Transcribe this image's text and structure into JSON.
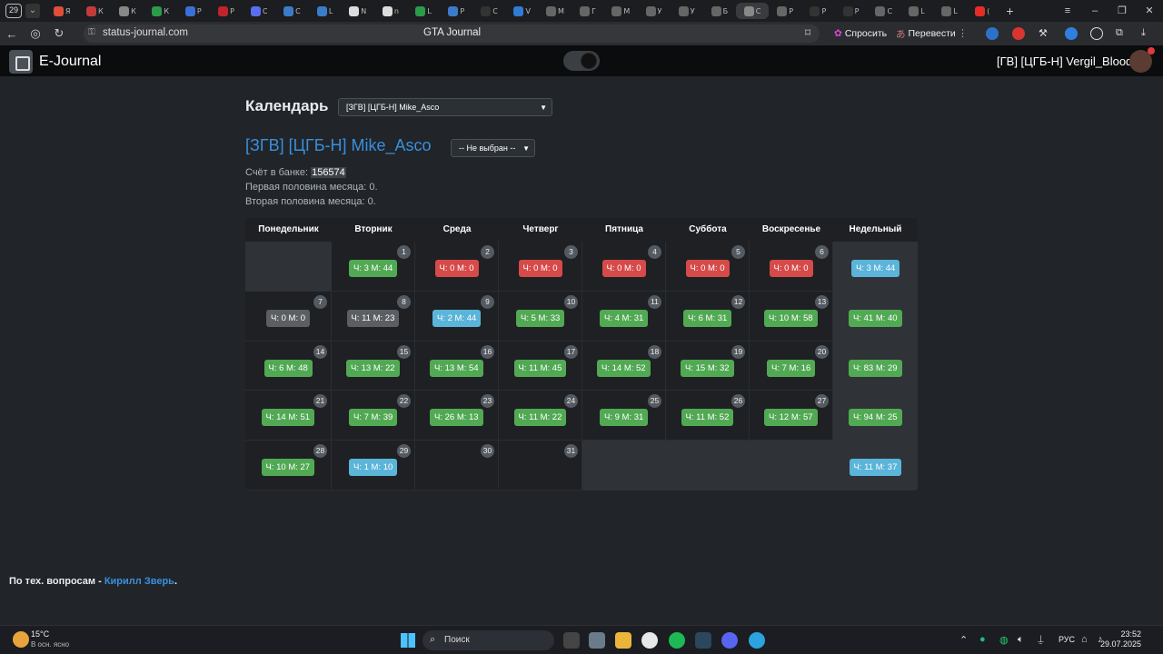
{
  "browser": {
    "tab_count": "29",
    "tabs": [
      {
        "title": "Я",
        "color": "#e04e39"
      },
      {
        "title": "К",
        "color": "#c23b3b"
      },
      {
        "title": "К",
        "color": "#888"
      },
      {
        "title": "К",
        "color": "#2b9b49"
      },
      {
        "title": "Р",
        "color": "#3a6fd8"
      },
      {
        "title": "Р",
        "color": "#c0232c"
      },
      {
        "title": "С",
        "color": "#5a6ef0"
      },
      {
        "title": "С",
        "color": "#3b7cc9"
      },
      {
        "title": "L",
        "color": "#3b7cc9"
      },
      {
        "title": "N",
        "color": "#ddd"
      },
      {
        "title": "n",
        "color": "#ddd"
      },
      {
        "title": "L",
        "color": "#2b9b49"
      },
      {
        "title": "Р",
        "color": "#3b7cc9"
      },
      {
        "title": "C",
        "color": "#333"
      },
      {
        "title": "V",
        "color": "#2f7bd6"
      },
      {
        "title": "М",
        "color": "#666"
      },
      {
        "title": "Г",
        "color": "#666"
      },
      {
        "title": "М",
        "color": "#666"
      },
      {
        "title": "У",
        "color": "#666"
      },
      {
        "title": "У",
        "color": "#666"
      },
      {
        "title": "Б",
        "color": "#666"
      },
      {
        "title": "С",
        "color": "#888"
      },
      {
        "title": "Р",
        "color": "#666"
      },
      {
        "title": "Р",
        "color": "#333"
      },
      {
        "title": "Р",
        "color": "#333"
      },
      {
        "title": "С",
        "color": "#666"
      },
      {
        "title": "L",
        "color": "#666"
      },
      {
        "title": "L",
        "color": "#666"
      },
      {
        "title": "(",
        "color": "#e52d27"
      }
    ],
    "url": "status-journal.com",
    "page_title": "GTA Journal",
    "ask_label": "Спросить",
    "translate_label": "Перевести"
  },
  "header": {
    "brand": "E-Journal",
    "user": "[ГВ] [ЦГБ-Н] Vergil_Blood"
  },
  "main": {
    "title": "Календарь",
    "employee_select": "[ЗГВ] [ЦГБ-Н] Mike_Asco",
    "person_name": "[ЗГВ] [ЦГБ-Н] Mike_Asco",
    "status_select": "-- Не выбран --",
    "bank_label": "Счёт в банке: ",
    "bank_value": "156574",
    "first_half": "Первая половина месяца: 0.",
    "second_half": "Вторая половина месяца: 0."
  },
  "calendar": {
    "days": [
      "Понедельник",
      "Вторник",
      "Среда",
      "Четверг",
      "Пятница",
      "Суббота",
      "Воскресенье",
      "Недельный"
    ],
    "weeks": [
      [
        null,
        {
          "d": "1",
          "t": "Ч: 3 М: 44",
          "c": "green"
        },
        {
          "d": "2",
          "t": "Ч: 0 М: 0",
          "c": "red"
        },
        {
          "d": "3",
          "t": "Ч: 0 М: 0",
          "c": "red"
        },
        {
          "d": "4",
          "t": "Ч: 0 М: 0",
          "c": "red"
        },
        {
          "d": "5",
          "t": "Ч: 0 М: 0",
          "c": "red"
        },
        {
          "d": "6",
          "t": "Ч: 0 М: 0",
          "c": "red"
        },
        {
          "t": "Ч: 3 М: 44",
          "c": "blue"
        }
      ],
      [
        {
          "d": "7",
          "t": "Ч: 0 М: 0",
          "c": "gray"
        },
        {
          "d": "8",
          "t": "Ч: 11 М: 23",
          "c": "gray"
        },
        {
          "d": "9",
          "t": "Ч: 2 М: 44",
          "c": "blue"
        },
        {
          "d": "10",
          "t": "Ч: 5 М: 33",
          "c": "green"
        },
        {
          "d": "11",
          "t": "Ч: 4 М: 31",
          "c": "green"
        },
        {
          "d": "12",
          "t": "Ч: 6 М: 31",
          "c": "green"
        },
        {
          "d": "13",
          "t": "Ч: 10 М: 58",
          "c": "green"
        },
        {
          "t": "Ч: 41 М: 40",
          "c": "green"
        }
      ],
      [
        {
          "d": "14",
          "t": "Ч: 6 М: 48",
          "c": "green"
        },
        {
          "d": "15",
          "t": "Ч: 13 М: 22",
          "c": "green"
        },
        {
          "d": "16",
          "t": "Ч: 13 М: 54",
          "c": "green"
        },
        {
          "d": "17",
          "t": "Ч: 11 М: 45",
          "c": "green"
        },
        {
          "d": "18",
          "t": "Ч: 14 М: 52",
          "c": "green"
        },
        {
          "d": "19",
          "t": "Ч: 15 М: 32",
          "c": "green"
        },
        {
          "d": "20",
          "t": "Ч: 7 М: 16",
          "c": "green"
        },
        {
          "t": "Ч: 83 М: 29",
          "c": "green"
        }
      ],
      [
        {
          "d": "21",
          "t": "Ч: 14 М: 51",
          "c": "green"
        },
        {
          "d": "22",
          "t": "Ч: 7 М: 39",
          "c": "green"
        },
        {
          "d": "23",
          "t": "Ч: 26 М: 13",
          "c": "green"
        },
        {
          "d": "24",
          "t": "Ч: 11 М: 22",
          "c": "green"
        },
        {
          "d": "25",
          "t": "Ч: 9 М: 31",
          "c": "green"
        },
        {
          "d": "26",
          "t": "Ч: 11 М: 52",
          "c": "green"
        },
        {
          "d": "27",
          "t": "Ч: 12 М: 57",
          "c": "green"
        },
        {
          "t": "Ч: 94 М: 25",
          "c": "green"
        }
      ],
      [
        {
          "d": "28",
          "t": "Ч: 10 М: 27",
          "c": "green"
        },
        {
          "d": "29",
          "t": "Ч: 1 М: 10",
          "c": "blue"
        },
        {
          "d": "30"
        },
        {
          "d": "31"
        },
        null,
        null,
        null,
        {
          "t": "Ч: 11 М: 37",
          "c": "blue"
        }
      ]
    ]
  },
  "footer": {
    "prefix": "По тех. вопросам - ",
    "link": "Кирилл Зверь",
    "suffix": "."
  },
  "taskbar": {
    "temp": "15°C",
    "weather_desc": "В осн. ясно",
    "search": "Поиск",
    "lang": "РУС",
    "time": "23:52",
    "date": "29.07.2025"
  }
}
